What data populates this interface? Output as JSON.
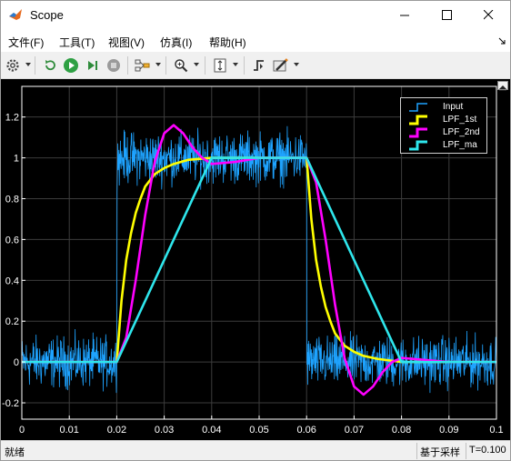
{
  "window": {
    "title": "Scope"
  },
  "menu": [
    {
      "label": "文件(F)"
    },
    {
      "label": "工具(T)"
    },
    {
      "label": "视图(V)"
    },
    {
      "label": "仿真(I)"
    },
    {
      "label": "帮助(H)"
    }
  ],
  "toolbar": {
    "icons": [
      "gear-icon",
      "restore-icon",
      "step-back-icon",
      "run-icon",
      "stop-icon",
      "signal-select-icon",
      "zoom-icon",
      "autoscale-icon",
      "trigger-icon",
      "measure-icon"
    ]
  },
  "status": {
    "text": "就绪",
    "sampling": "基于采样",
    "time": "T=0.100"
  },
  "colors": {
    "background": "#000000",
    "axes": "#ffffff",
    "grid": "#3c3c3c",
    "input": "#1ea3ff",
    "lpf_1st": "#ffff00",
    "lpf_2nd": "#ff00ff",
    "lpf_ma": "#2ee6ec"
  },
  "chart_data": {
    "type": "line",
    "title": "",
    "xlabel": "",
    "ylabel": "",
    "xlim": [
      0,
      0.1
    ],
    "ylim": [
      -0.28,
      1.35
    ],
    "xticks": [
      "0",
      "0.01",
      "0.02",
      "0.03",
      "0.04",
      "0.05",
      "0.06",
      "0.07",
      "0.08",
      "0.09",
      "0.1"
    ],
    "yticks": [
      "-0.2",
      "0",
      "0.2",
      "0.4",
      "0.6",
      "0.8",
      "1",
      "1.2"
    ],
    "grid": true,
    "legend_position": "top-right",
    "series": [
      {
        "name": "Input",
        "color": "#1ea3ff",
        "style": "noisy",
        "x": [
          0,
          0.02,
          0.02,
          0.06,
          0.06,
          0.1
        ],
        "y": [
          0,
          0,
          1,
          1,
          0,
          0
        ],
        "noise_amplitude": 0.1
      },
      {
        "name": "LPF_1st",
        "color": "#ffff00",
        "x": [
          0,
          0.02,
          0.021,
          0.022,
          0.023,
          0.024,
          0.025,
          0.026,
          0.028,
          0.03,
          0.032,
          0.035,
          0.04,
          0.05,
          0.06,
          0.061,
          0.062,
          0.063,
          0.064,
          0.065,
          0.066,
          0.068,
          0.07,
          0.072,
          0.075,
          0.08,
          0.09,
          0.1
        ],
        "y": [
          0,
          0,
          0.3,
          0.5,
          0.63,
          0.73,
          0.8,
          0.86,
          0.92,
          0.95,
          0.97,
          0.99,
          1.0,
          1.0,
          1.0,
          0.7,
          0.5,
          0.37,
          0.27,
          0.2,
          0.14,
          0.08,
          0.05,
          0.03,
          0.015,
          0.0,
          0.0,
          0.0
        ]
      },
      {
        "name": "LPF_2nd",
        "color": "#ff00ff",
        "x": [
          0,
          0.02,
          0.022,
          0.024,
          0.026,
          0.028,
          0.03,
          0.032,
          0.034,
          0.036,
          0.038,
          0.04,
          0.045,
          0.05,
          0.06,
          0.062,
          0.064,
          0.066,
          0.068,
          0.07,
          0.072,
          0.074,
          0.076,
          0.078,
          0.08,
          0.085,
          0.09,
          0.1
        ],
        "y": [
          0,
          0,
          0.12,
          0.4,
          0.72,
          0.98,
          1.12,
          1.16,
          1.12,
          1.05,
          1.0,
          0.97,
          0.98,
          1.0,
          1.0,
          0.88,
          0.6,
          0.28,
          0.02,
          -0.12,
          -0.16,
          -0.12,
          -0.05,
          0.0,
          0.02,
          0.01,
          0.0,
          0.0
        ]
      },
      {
        "name": "LPF_ma",
        "color": "#2ee6ec",
        "x": [
          0,
          0.02,
          0.04,
          0.06,
          0.08,
          0.1
        ],
        "y": [
          0,
          0,
          1,
          1,
          0,
          0
        ]
      }
    ]
  }
}
